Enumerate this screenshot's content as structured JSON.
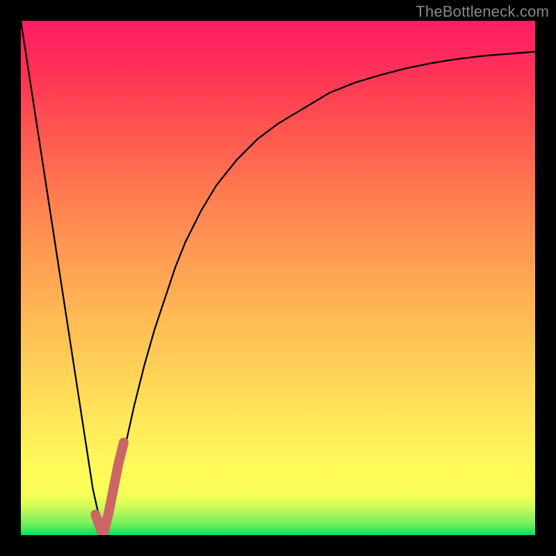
{
  "watermark": "TheBottleneck.com",
  "colors": {
    "background": "#000000",
    "curve_stroke": "#000000",
    "marker_stroke": "#cc6666",
    "gradient_top": "#ff1d64",
    "gradient_bottom": "#00e060"
  },
  "chart_data": {
    "type": "line",
    "title": "",
    "xlabel": "",
    "ylabel": "",
    "xlim": [
      0,
      100
    ],
    "ylim": [
      0,
      100
    ],
    "grid": false,
    "legend": false,
    "series": [
      {
        "name": "bottleneck-curve",
        "x": [
          0,
          2,
          4,
          6,
          8,
          10,
          12,
          14,
          16,
          18,
          20,
          22,
          24,
          26,
          28,
          30,
          32,
          35,
          38,
          42,
          46,
          50,
          55,
          60,
          65,
          70,
          75,
          80,
          85,
          90,
          95,
          100
        ],
        "y": [
          100,
          87,
          74,
          61,
          48,
          35,
          22,
          9,
          0,
          7,
          16,
          25,
          33,
          40,
          46,
          52,
          57,
          63,
          68,
          73,
          77,
          80,
          83,
          86,
          88,
          89.5,
          90.8,
          91.8,
          92.6,
          93.2,
          93.6,
          94
        ]
      },
      {
        "name": "highlight-segment",
        "x": [
          14.5,
          15.2,
          16,
          17,
          18,
          19,
          20
        ],
        "y": [
          4,
          2,
          0,
          4,
          9,
          14,
          18
        ]
      }
    ],
    "annotations": []
  }
}
